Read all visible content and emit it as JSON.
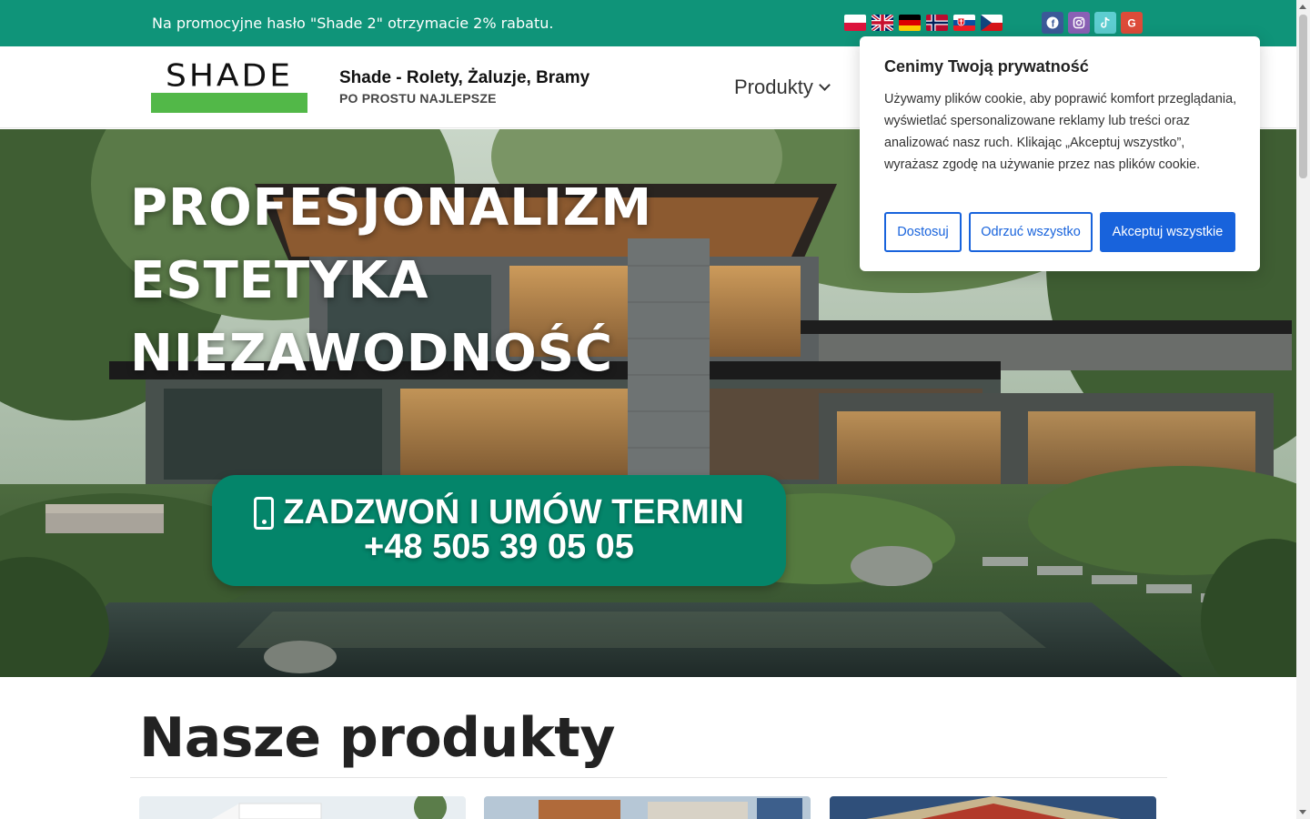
{
  "topbar": {
    "promo_text": "Na promocyjne hasło \"Shade 2\" otrzymacie 2% rabatu.",
    "flags": [
      "pl",
      "gb",
      "de",
      "no",
      "sk",
      "cz"
    ],
    "socials": [
      {
        "name": "facebook-icon",
        "glyph": "f",
        "color": "#3b5998"
      },
      {
        "name": "instagram-icon",
        "glyph": "◎",
        "color": "#8a60b5"
      },
      {
        "name": "tiktok-icon",
        "glyph": "♪",
        "color": "#5dcdd0"
      },
      {
        "name": "google-icon",
        "glyph": "G",
        "color": "#dd4b39"
      }
    ],
    "bg_color": "#0f9479"
  },
  "header": {
    "logo_text": "SHADE",
    "site_title": "Shade - Rolety, Żaluzje, Bramy",
    "tagline": "PO PROSTU NAJLEPSZE",
    "nav": {
      "produkty_label": "Produkty"
    }
  },
  "hero": {
    "lines": [
      "PROFESJONALIZM",
      "ESTETYKA",
      "NIEZAWODNOŚĆ"
    ],
    "cta_line1": "ZADZWOŃ I UMÓW TERMIN",
    "cta_line2": "+48 505 39 05 05",
    "cta_color": "#04856a"
  },
  "products": {
    "title": "Nasze produkty"
  },
  "cookie": {
    "title": "Cenimy Twoją prywatność",
    "text": "Używamy plików cookie, aby poprawić komfort przeglądania, wyświetlać spersonalizowane reklamy lub treści oraz analizować nasz ruch. Klikając „Akceptuj wszystko”, wyrażasz zgodę na używanie przez nas plików cookie.",
    "customize_label": "Dostosuj",
    "reject_label": "Odrzuć wszystko",
    "accept_label": "Akceptuj wszystkie",
    "accent_color": "#1863dc"
  }
}
